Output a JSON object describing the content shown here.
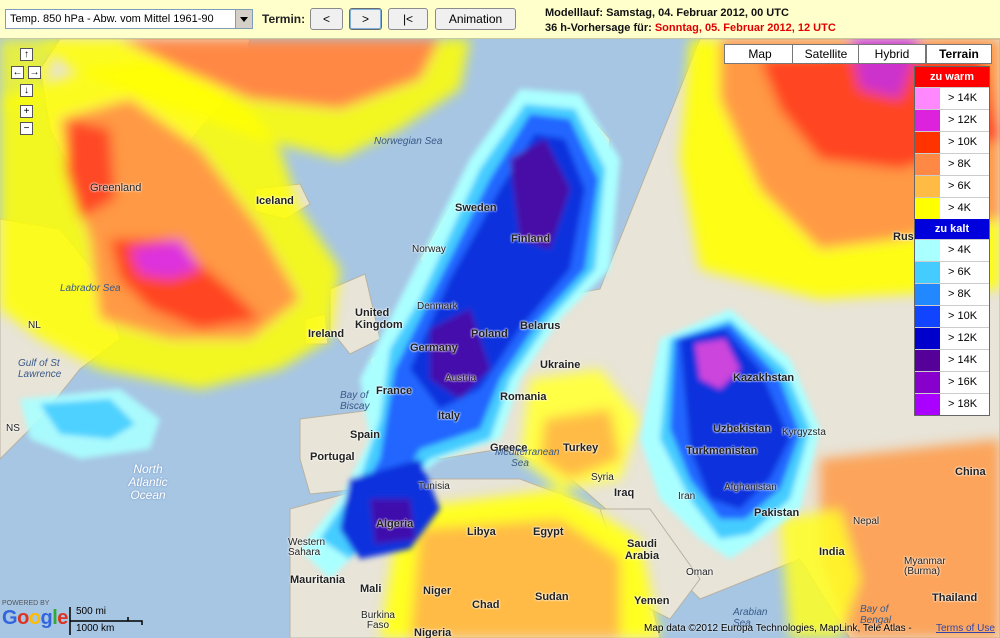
{
  "toolbar": {
    "parameter_select": "Temp. 850 hPa - Abw. vom Mittel 1961-90",
    "termin_label": "Termin:",
    "prev_label": "<",
    "next_label": ">",
    "first_label": "|<",
    "animation_label": "Animation",
    "run_label": "Modelllauf: Samstag, 04. Februar 2012, 00 UTC",
    "forecast_prefix": "36 h-Vorhersage für:",
    "forecast_date": "Sonntag, 05. Februar 2012, 12 UTC"
  },
  "nav": {
    "up": "↑",
    "left": "←",
    "right": "→",
    "down": "↓",
    "zoom_in": "+",
    "zoom_out": "−"
  },
  "map_types": [
    "Map",
    "Satellite",
    "Hybrid",
    "Terrain"
  ],
  "map_type_active": "Terrain",
  "legend": {
    "warm_header": "zu warm",
    "warm_color": "#ff0000",
    "warm": [
      {
        "label": "> 14K",
        "color": "#ff88ff"
      },
      {
        "label": "> 12K",
        "color": "#dd22dd"
      },
      {
        "label": "> 10K",
        "color": "#ff3300"
      },
      {
        "label": "> 8K",
        "color": "#ff8844"
      },
      {
        "label": "> 6K",
        "color": "#ffbb44"
      },
      {
        "label": "> 4K",
        "color": "#ffff00"
      }
    ],
    "cold_header": "zu kalt",
    "cold_color": "#0000dd",
    "cold": [
      {
        "label": "> 4K",
        "color": "#aaffff"
      },
      {
        "label": "> 6K",
        "color": "#44ccff"
      },
      {
        "label": "> 8K",
        "color": "#2288ff"
      },
      {
        "label": "> 10K",
        "color": "#1144ff"
      },
      {
        "label": "> 12K",
        "color": "#0000cc"
      },
      {
        "label": "> 14K",
        "color": "#550099"
      },
      {
        "label": "> 16K",
        "color": "#8800cc"
      },
      {
        "label": "> 18K",
        "color": "#aa00ff"
      }
    ]
  },
  "places": {
    "greenland": "Greenland",
    "iceland": "Iceland",
    "norwegian_sea": "Norwegian Sea",
    "sweden": "Sweden",
    "finland": "Finland",
    "norway": "Norway",
    "labrador_sea": "Labrador Sea",
    "nl": "NL",
    "united_kingdom": "United Kingdom",
    "ireland": "Ireland",
    "denmark": "Denmark",
    "poland": "Poland",
    "belarus": "Belarus",
    "germany": "Germany",
    "austria": "Austria",
    "france": "France",
    "ukraine": "Ukraine",
    "kazakhstan": "Kazakhstan",
    "bay_of_biscay": "Bay of Biscay",
    "italy": "Italy",
    "romania": "Romania",
    "uzbekistan": "Uzbekistan",
    "kyrgyzsta": "Kyrgyzsta",
    "spain": "Spain",
    "portugal": "Portugal",
    "greece": "Greece",
    "turkey": "Turkey",
    "turkmenistan": "Turkmenistan",
    "china": "China",
    "gulf_of_st_lawrence": "Gulf of St Lawrence",
    "ns": "NS",
    "north_atlantic_ocean": "North Atlantic Ocean",
    "mediterranean_sea": "Mediterranean Sea",
    "tunisia": "Tunisia",
    "syria": "Syria",
    "iraq": "Iraq",
    "iran": "Iran",
    "afghanistan": "Afghanistan",
    "pakistan": "Pakistan",
    "algeria": "Algeria",
    "libya": "Libya",
    "egypt": "Egypt",
    "western_sahara": "Western Sahara",
    "saudi_arabia": "Saudi Arabia",
    "nepal": "Nepal",
    "india": "India",
    "myanmar": "Myanmar (Burma)",
    "oman": "Oman",
    "mauritania": "Mauritania",
    "mali": "Mali",
    "niger": "Niger",
    "sudan": "Sudan",
    "chad": "Chad",
    "burkina_faso": "Burkina Faso",
    "nigeria": "Nigeria",
    "yemen": "Yemen",
    "arabian_sea": "Arabian Sea",
    "bay_of_bengal": "Bay of Bengal",
    "thailand": "Thailand",
    "rus": "Rus"
  },
  "footer": {
    "powered_by": "POWERED BY",
    "google": "Google",
    "scale_mi": "500 mi",
    "scale_km": "1000 km",
    "copyright": "Map data ©2012 Europa Technologies, MapLink, Tele Atlas -",
    "terms": "Terms of Use"
  }
}
